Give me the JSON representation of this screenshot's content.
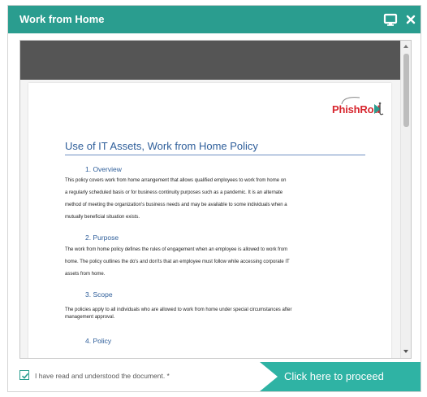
{
  "window": {
    "title": "Work from Home",
    "title_bar_color": "#2a9d8f",
    "accent_color": "#2fb3a4",
    "icons": [
      "monitor-icon",
      "close-icon"
    ]
  },
  "document": {
    "logo_text": "PhishRod",
    "title": "Use of IT Assets, Work from Home Policy",
    "sections": [
      {
        "heading": "1.  Overview",
        "lines": [
          "This policy covers work from home arrangement that allows qualified employees to work from home on",
          "a regularly scheduled basis or for business continuity purposes such as a pandemic.  It is an alternate",
          "method of meeting the organization's business needs and may be available to some individuals when a",
          "mutually beneficial situation exists."
        ]
      },
      {
        "heading": "2.  Purpose",
        "lines": [
          "The work from home policy defines the rules of engagement when an employee is allowed to work from",
          "home. The policy outlines the do's and don'ts that an employee must follow while accessing corporate IT",
          "assets from home."
        ]
      },
      {
        "heading": "3.  Scope",
        "lines": [
          "The policies apply to all individuals who are allowed to work from home under special circumstances after",
          "management approval."
        ]
      },
      {
        "heading": "4.  Policy",
        "lines": []
      }
    ]
  },
  "footer": {
    "checkbox_checked": true,
    "checkbox_label": "I have read and understood the document. *",
    "proceed_label": "Click here to proceed"
  }
}
